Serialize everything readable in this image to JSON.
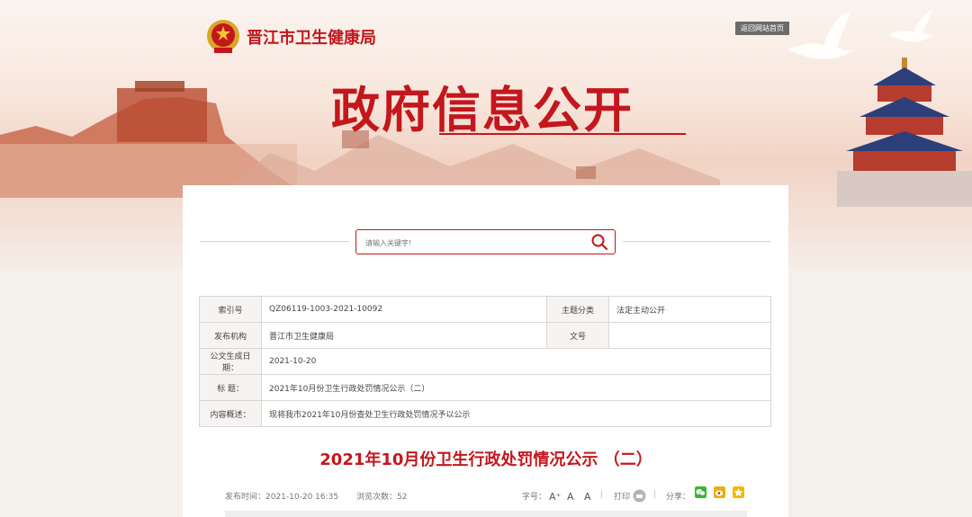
{
  "header": {
    "site_name": "晋江市卫生健康局",
    "home_link": "返回网站首页",
    "banner_title": "政府信息公开"
  },
  "search": {
    "placeholder": "请输入关键字!"
  },
  "meta": {
    "index_label": "索引号",
    "index_value": "QZ06119-1003-2021-10092",
    "category_label": "主题分类",
    "category_value": "法定主动公开",
    "publisher_label": "发布机构",
    "publisher_value": "晋江市卫生健康局",
    "docno_label": "文号",
    "docno_value": "",
    "date_label": "公文生成日期：",
    "date_value": "2021-10-20",
    "title_label": "标 题：",
    "title_value": "2021年10月份卫生行政处罚情况公示（二）",
    "summary_label": "内容概述：",
    "summary_value": "现将我市2021年10月份查处卫生行政处罚情况予以公示"
  },
  "article": {
    "title": "2021年10月份卫生行政处罚情况公示 （二）",
    "publish_time": "发布时间：2021-10-20 16:35",
    "views": "浏览次数：52",
    "font_size_label": "字号：",
    "font_large": "A⁺",
    "font_mid": "A",
    "font_small": "A",
    "print_label": "打印",
    "share_label": "分享："
  },
  "colors": {
    "accent": "#c3171d",
    "wechat": "#3fb236",
    "weibo": "#e8b10d",
    "qzone": "#f2b707"
  }
}
